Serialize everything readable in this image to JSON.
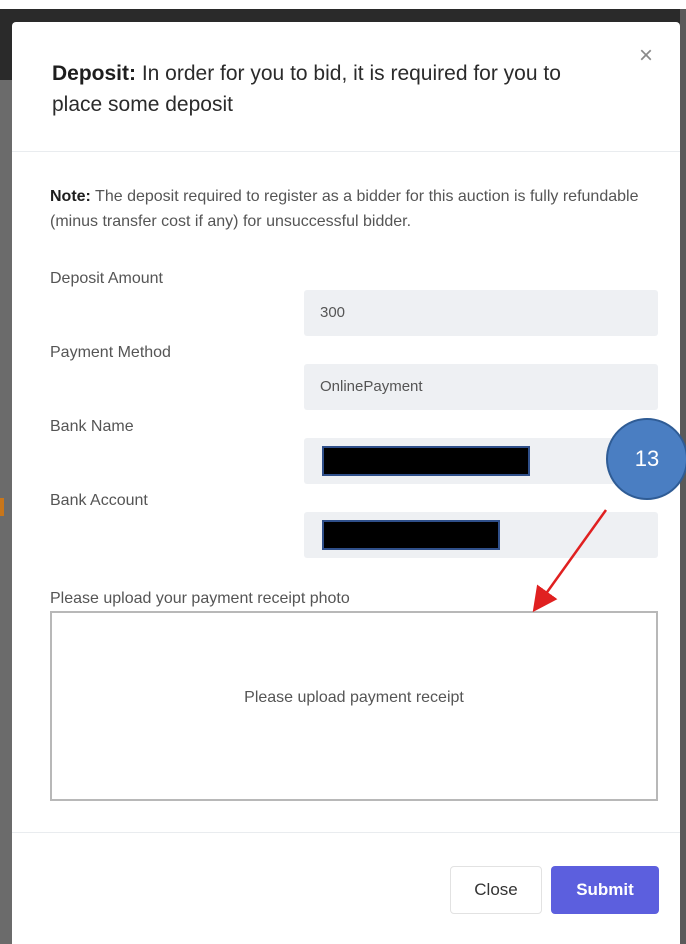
{
  "modal": {
    "title_bold": "Deposit:",
    "title_rest": " In order for you to bid, it is required for you to place some deposit",
    "close_glyph": "×",
    "note_bold": "Note:",
    "note_rest": " The deposit required to register as a bidder for this auction is fully refundable (minus transfer cost if any) for unsuccessful bidder.",
    "fields": [
      {
        "label": "Deposit Amount",
        "value": "300"
      },
      {
        "label": "Payment Method",
        "value": "OnlinePayment"
      },
      {
        "label": "Bank Name",
        "value": ""
      },
      {
        "label": "Bank Account",
        "value": ""
      }
    ],
    "upload_label": "Please upload your payment receipt photo",
    "upload_placeholder": "Please upload payment receipt",
    "footer": {
      "close_label": "Close",
      "submit_label": "Submit"
    }
  },
  "annotation": {
    "number": "13"
  },
  "colors": {
    "accent": "#5c5fde",
    "callout": "#4a7ec2",
    "arrow": "#e02020"
  }
}
